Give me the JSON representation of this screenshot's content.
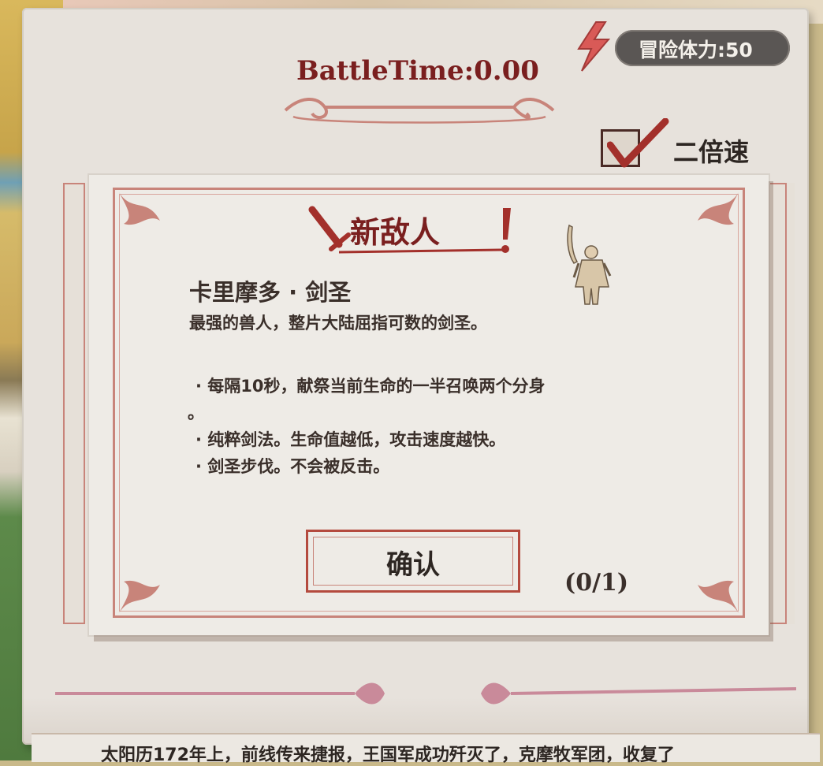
{
  "hud": {
    "battle_time": "BattleTime:0.00",
    "stamina_label": "冒险体力:50",
    "speed_label": "二倍速",
    "speed_checked": true
  },
  "dialog": {
    "title": "新敌人",
    "enemy_name": "卡里摩多 · 剑圣",
    "enemy_description": "最强的兽人，整片大陆屈指可数的剑圣。",
    "abilities": [
      "· 每隔10秒，献祭当前生命的一半召唤两个分身",
      "。",
      "· 纯粹剑法。生命值越低，攻击速度越快。",
      "· 剑圣步伐。不会被反击。"
    ],
    "confirm_label": "确认",
    "counter": "(0/1)"
  },
  "story_text": "太阳历172年上，前线传来捷报，王国军成功歼灭了，克摩牧军团，收复了",
  "colors": {
    "accent_red": "#7a1f1f",
    "frame": "#c8847a",
    "parchment": "#e7e2dc",
    "stamina_bg": "#5a5654"
  }
}
